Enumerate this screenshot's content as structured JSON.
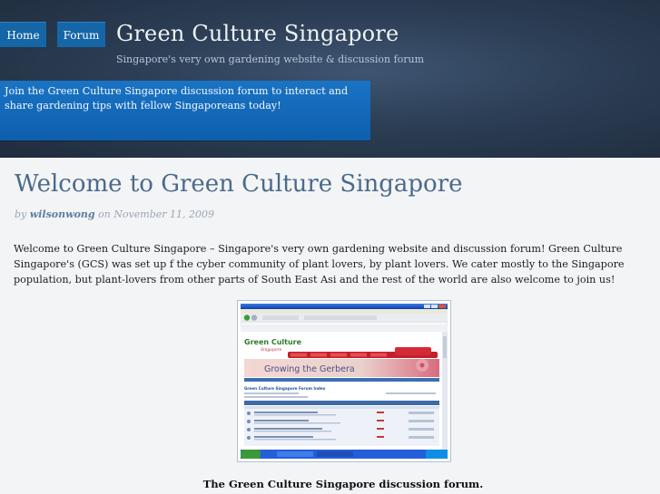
{
  "nav": {
    "home": "Home",
    "forum": "Forum"
  },
  "site": {
    "title": "Green Culture Singapore",
    "tagline": "Singapore's very own gardening website & discussion forum"
  },
  "promo": {
    "text": "Join the Green Culture Singapore discussion forum to interact and share gardening tips with fellow Singaporeans today!"
  },
  "post": {
    "title": "Welcome to Green Culture Singapore",
    "by": "by",
    "author": "wilsonwong",
    "date": "on November 11, 2009",
    "body": "Welcome to Green Culture Singapore – Singapore's very own gardening website and discussion forum! Green Culture Singapore's (GCS) was set up f the cyber community of plant lovers, by plant lovers. We cater mostly to the Singapore population, but plant-lovers from other parts of South East Asi and the rest of the world are also welcome to join us!",
    "image_alt": "Screenshot of the Green Culture Singapore forum",
    "caption": "The Green Culture Singapore discussion forum."
  },
  "screenshot": {
    "window_title": "Green Culture Singapore - Index - Microsoft Internet Explorer",
    "logo": "Green Culture",
    "logo_sub": "Singapore",
    "banner": "Growing the Gerbera",
    "index_heading": "Green Culture Singapore Forum Index"
  },
  "colors": {
    "header_dark": "#1f2c3d",
    "nav_blue": "#1566a7",
    "promo_blue": "#1a73c4",
    "title_blue": "#4b6a8a",
    "page_bg": "#f3f4f6"
  }
}
